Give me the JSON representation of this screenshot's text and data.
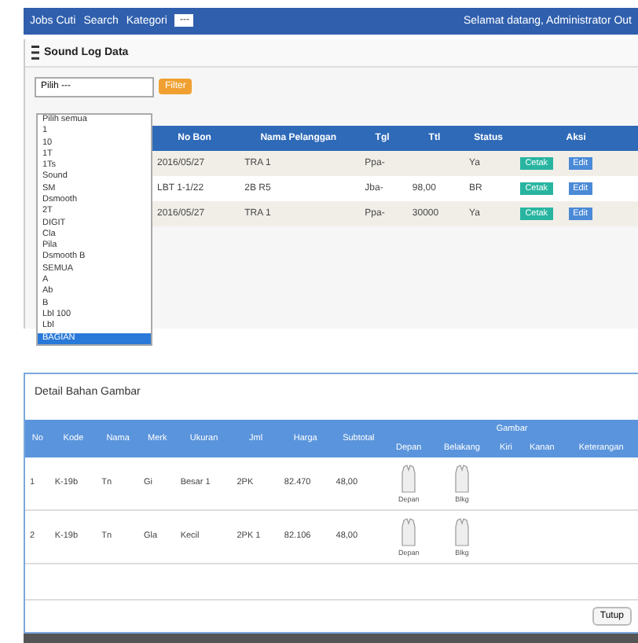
{
  "navbar": {
    "items": [
      "Jobs Cuti",
      "Search",
      "Kategori"
    ],
    "select_value": "---",
    "user_text": "Selamat datang, Administrator  Out"
  },
  "panel": {
    "title": "Sound Log Data"
  },
  "filter": {
    "select_value": "Pilih ---",
    "button": "Filter",
    "options": [
      {
        "label": "Pilih semua",
        "selected": false
      },
      {
        "label": "1",
        "selected": false
      },
      {
        "label": "10",
        "selected": false
      },
      {
        "label": "1T",
        "selected": false
      },
      {
        "label": "1Ts",
        "selected": false
      },
      {
        "label": "Sound",
        "selected": false
      },
      {
        "label": "SM",
        "selected": false
      },
      {
        "label": "Dsmooth",
        "selected": false
      },
      {
        "label": "2T",
        "selected": false
      },
      {
        "label": "DIGIT",
        "selected": false
      },
      {
        "label": "Cla",
        "selected": false
      },
      {
        "label": "Pila",
        "selected": false
      },
      {
        "label": "Dsmooth B",
        "selected": false
      },
      {
        "label": "SEMUA",
        "selected": false
      },
      {
        "label": "A",
        "selected": false
      },
      {
        "label": "Ab",
        "selected": false
      },
      {
        "label": "B",
        "selected": false
      },
      {
        "label": "Lbl 100",
        "selected": false
      },
      {
        "label": "Lbl",
        "selected": false
      },
      {
        "label": "BAGIAN",
        "selected": true
      }
    ]
  },
  "table": {
    "columns": [
      "No Bon",
      "Nama Pelanggan",
      "Tgl",
      "Ttl",
      "Status",
      "Aksi"
    ],
    "rows": [
      {
        "cells": [
          "2016/05/27",
          "TRA 1",
          "Ppa-",
          "",
          "Ya"
        ],
        "actions": [
          "Cetak",
          "Edit"
        ]
      },
      {
        "cells": [
          "LBT 1-1/22",
          "2B R5",
          "Jba-",
          "98,00",
          "BR"
        ],
        "actions": [
          "Cetak",
          "Edit"
        ]
      },
      {
        "cells": [
          "2016/05/27",
          "TRA 1",
          "Ppa-",
          "30000",
          "Ya"
        ],
        "actions": [
          "Cetak",
          "Edit"
        ]
      }
    ]
  },
  "detail": {
    "title": "Detail Bahan Gambar",
    "columns": [
      "No",
      "Kode",
      "Nama",
      "Merk",
      "Ukuran",
      "Jml",
      "Harga",
      "Subtotal"
    ],
    "group": "Gambar",
    "subcolumns": [
      "Depan",
      "Belakang",
      "Kiri",
      "Kanan",
      "Keterangan"
    ],
    "rows": [
      {
        "cells": [
          "1",
          "K-19b",
          "Tn",
          "Gi",
          "Besar 1",
          "2PK",
          "82.470",
          "48,00"
        ],
        "images": [
          "Depan",
          "Blkg"
        ]
      },
      {
        "cells": [
          "2",
          "K-19b",
          "Tn",
          "Gla",
          "Kecil",
          "2PK 1",
          "82.106",
          "48,00"
        ],
        "images": [
          "Depan",
          "Blkg"
        ]
      }
    ],
    "button": "Tutup"
  }
}
